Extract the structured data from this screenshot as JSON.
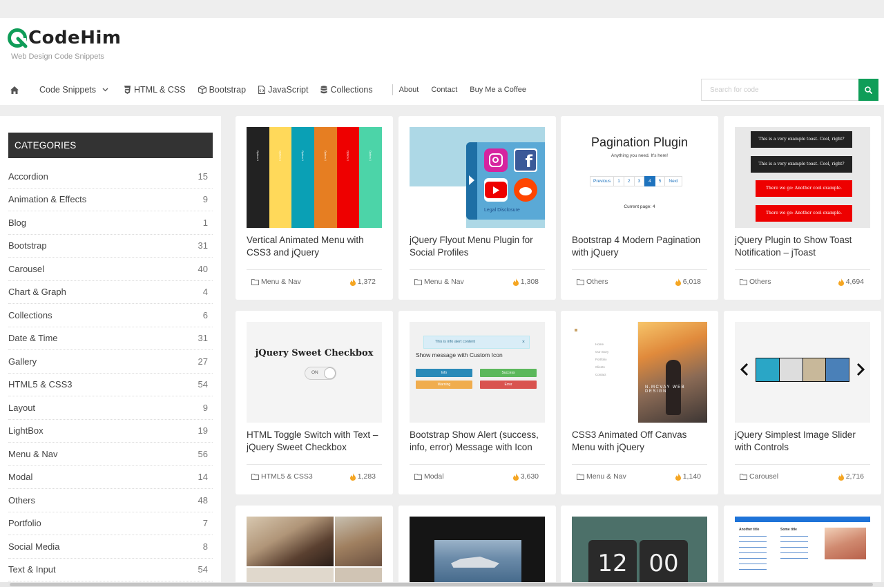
{
  "brand": {
    "name": "CodeHim",
    "tagline": "Web Design Code Snippets"
  },
  "nav": {
    "home_icon": "home-icon",
    "items": [
      {
        "label": "Code Snippets",
        "icon": "chevron-down-icon"
      },
      {
        "label": "HTML & CSS",
        "icon": "css3-icon"
      },
      {
        "label": "Bootstrap",
        "icon": "cube-icon"
      },
      {
        "label": "JavaScript",
        "icon": "file-code-icon"
      },
      {
        "label": "Collections",
        "icon": "database-icon"
      }
    ],
    "small_links": [
      "About",
      "Contact",
      "Buy Me a Coffee"
    ]
  },
  "search": {
    "placeholder": "Search for code",
    "button_icon": "search-icon",
    "button_color": "#0f9d58"
  },
  "sidebar": {
    "title": "CATEGORIES",
    "categories": [
      {
        "name": "Accordion",
        "count": "15"
      },
      {
        "name": "Animation & Effects",
        "count": "9"
      },
      {
        "name": "Blog",
        "count": "1"
      },
      {
        "name": "Bootstrap",
        "count": "31"
      },
      {
        "name": "Carousel",
        "count": "40"
      },
      {
        "name": "Chart & Graph",
        "count": "4"
      },
      {
        "name": "Collections",
        "count": "6"
      },
      {
        "name": "Date & Time",
        "count": "31"
      },
      {
        "name": "Gallery",
        "count": "27"
      },
      {
        "name": "HTML5 & CSS3",
        "count": "54"
      },
      {
        "name": "Layout",
        "count": "9"
      },
      {
        "name": "LightBox",
        "count": "19"
      },
      {
        "name": "Menu & Nav",
        "count": "56"
      },
      {
        "name": "Modal",
        "count": "14"
      },
      {
        "name": "Others",
        "count": "48"
      },
      {
        "name": "Portfolio",
        "count": "7"
      },
      {
        "name": "Social Media",
        "count": "8"
      },
      {
        "name": "Text & Input",
        "count": "54"
      }
    ]
  },
  "cards": [
    {
      "title": "Vertical Animated Menu with CSS3 and jQuery",
      "category": "Menu & Nav",
      "views": "1,372",
      "thumb": {
        "option_label": "Option 1"
      }
    },
    {
      "title": "jQuery Flyout Menu Plugin for Social Profiles",
      "category": "Menu & Nav",
      "views": "1,308",
      "thumb": {
        "caption": "Legal Disclosure"
      }
    },
    {
      "title": "Bootstrap 4 Modern Pagination with jQuery",
      "category": "Others",
      "views": "6,018",
      "thumb": {
        "heading": "Pagination Plugin",
        "sub": "Anything you need. It's here!",
        "pages": [
          "Previous",
          "1",
          "2",
          "3",
          "4",
          "5",
          "Next"
        ],
        "current": "Current page: 4"
      }
    },
    {
      "title": "jQuery Plugin to Show Toast Notification – jToast",
      "category": "Others",
      "views": "4,694",
      "thumb": {
        "toast_dark": "This is a very example toast. Cool, right?",
        "toast_red": "There we go: Another cool example."
      }
    },
    {
      "title": "HTML Toggle Switch with Text – jQuery Sweet Checkbox",
      "category": "HTML5 & CSS3",
      "views": "1,283",
      "thumb": {
        "heading": "jQuery Sweet Checkbox",
        "switch": "ON"
      }
    },
    {
      "title": "Bootstrap Show Alert (success, info, error) Message with Icon",
      "category": "Modal",
      "views": "3,630",
      "thumb": {
        "alert": "This is info alert content",
        "heading": "Show message with Custom Icon",
        "buttons": [
          "Info",
          "Success",
          "Warning",
          "Error"
        ]
      }
    },
    {
      "title": "CSS3 Animated Off Canvas Menu with jQuery",
      "category": "Menu & Nav",
      "views": "1,140",
      "thumb": {
        "menu": [
          "Home",
          "Our Story",
          "Portfolio",
          "Clients",
          "Contact"
        ],
        "overlay": "N.MCVAY WEB DESIGN"
      }
    },
    {
      "title": "jQuery Simplest Image Slider with Controls",
      "category": "Carousel",
      "views": "2,716",
      "thumb": {}
    },
    {
      "title": "",
      "category": "",
      "views": "",
      "thumb": {}
    },
    {
      "title": "",
      "category": "",
      "views": "",
      "thumb": {}
    },
    {
      "title": "",
      "category": "",
      "views": "",
      "thumb": {
        "hour": "12",
        "minute": "00"
      }
    },
    {
      "title": "",
      "category": "",
      "views": "",
      "thumb": {
        "col1": "Another title",
        "col2": "Some title"
      }
    }
  ]
}
